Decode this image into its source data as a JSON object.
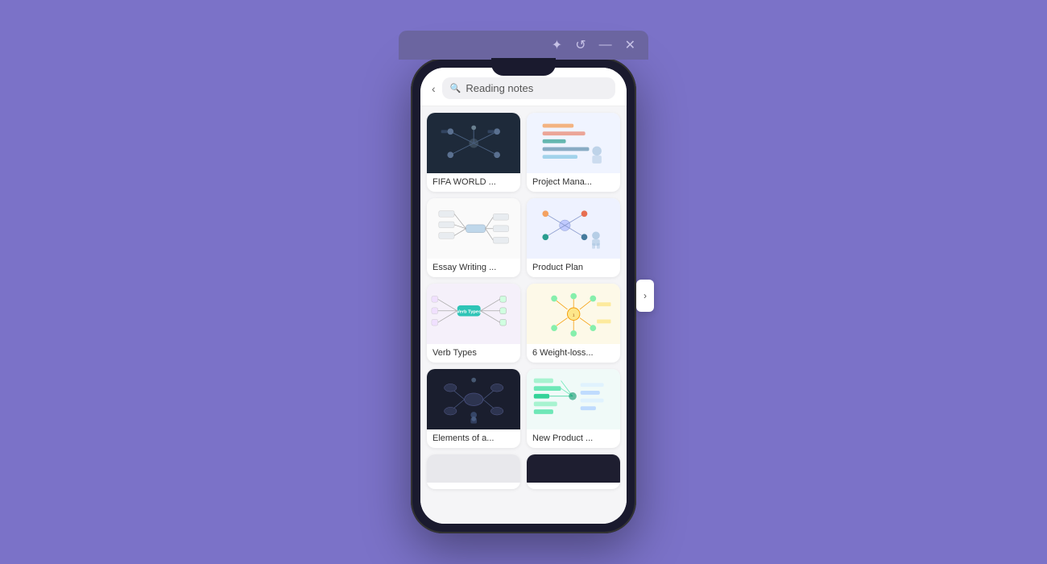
{
  "window": {
    "background_color": "#7b72c8"
  },
  "window_bar": {
    "icons": [
      {
        "name": "star-icon",
        "symbol": "✦"
      },
      {
        "name": "history-icon",
        "symbol": "↺"
      },
      {
        "name": "minimize-icon",
        "symbol": "—"
      },
      {
        "name": "close-icon",
        "symbol": "✕"
      }
    ]
  },
  "phone": {
    "search": {
      "placeholder": "Reading notes",
      "back_label": "‹"
    },
    "scroll_arrow": "›",
    "cards": [
      {
        "id": "fifa-world",
        "label": "FIFA WORLD ...",
        "thumb_type": "dark"
      },
      {
        "id": "project-mana",
        "label": "Project Mana...",
        "thumb_type": "light-blue"
      },
      {
        "id": "essay-writing",
        "label": "Essay Writing ...",
        "thumb_type": "white"
      },
      {
        "id": "product-plan",
        "label": "Product Plan",
        "thumb_type": "light-blue2"
      },
      {
        "id": "verb-types",
        "label": "Verb Types",
        "thumb_type": "white2"
      },
      {
        "id": "weight-loss",
        "label": "6 Weight-loss...",
        "thumb_type": "yellow"
      },
      {
        "id": "elements-of",
        "label": "Elements of a...",
        "thumb_type": "dark2"
      },
      {
        "id": "new-product",
        "label": "New Product ...",
        "thumb_type": "light-green"
      }
    ],
    "partial_cards": [
      {
        "id": "partial-1",
        "thumb_color": "#e0e0ea"
      },
      {
        "id": "partial-2",
        "thumb_color": "#1e1e2e"
      }
    ]
  }
}
